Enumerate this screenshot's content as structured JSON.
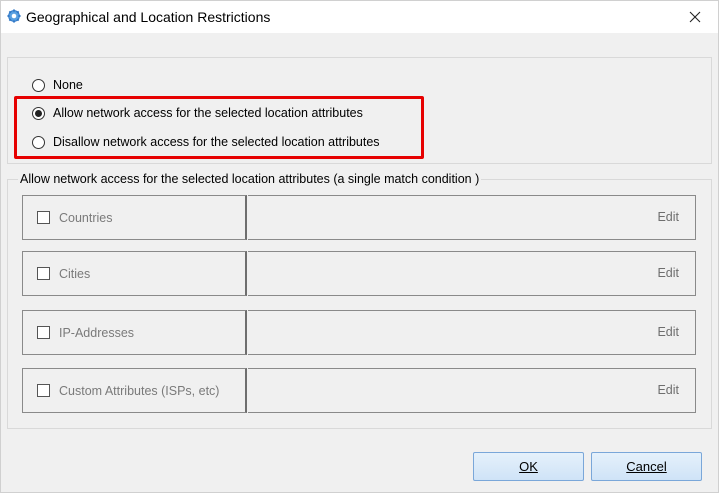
{
  "window": {
    "title": "Geographical and Location Restrictions",
    "icon": "gear-icon",
    "close_icon": "close-icon"
  },
  "access_mode": {
    "options": [
      {
        "label": "None",
        "checked": false
      },
      {
        "label": "Allow network access for the selected location attributes",
        "checked": true
      },
      {
        "label": "Disallow network access for the selected location attributes",
        "checked": false
      }
    ],
    "highlight_color": "#e60000"
  },
  "attributes_group": {
    "legend": "Allow network access for the selected location attributes (a single match condition )",
    "rows": [
      {
        "label": "Countries",
        "checked": false,
        "edit_label": "Edit"
      },
      {
        "label": "Cities",
        "checked": false,
        "edit_label": "Edit"
      },
      {
        "label": "IP-Addresses",
        "checked": false,
        "edit_label": "Edit"
      },
      {
        "label": "Custom Attributes (ISPs, etc)",
        "checked": false,
        "edit_label": "Edit"
      }
    ]
  },
  "buttons": {
    "ok": "OK",
    "cancel": "Cancel"
  }
}
